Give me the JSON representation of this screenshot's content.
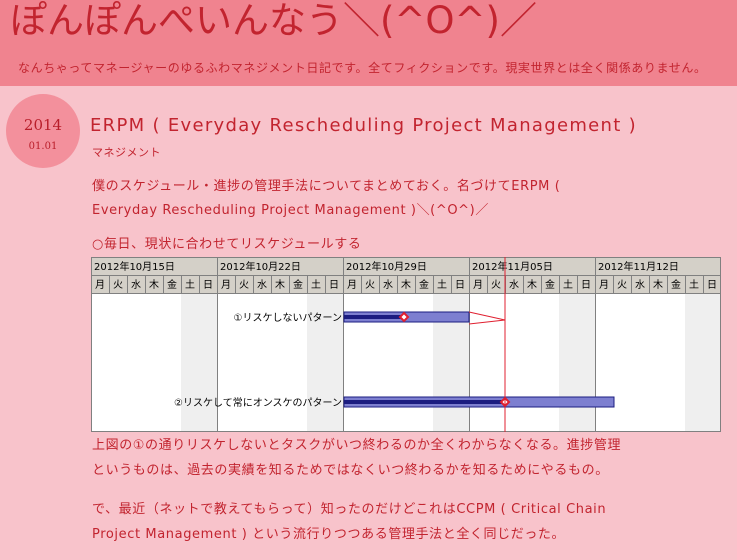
{
  "blog": {
    "title": "ぽんぽんぺいんなう＼(^O^)／",
    "description": "なんちゃってマネージャーのゆるふわマネジメント日記です。全てフィクションです。現実世界とは全く関係ありません。"
  },
  "post": {
    "date_year": "2014",
    "date_md": "01.01",
    "title": "ERPM ( Everyday Rescheduling Project Management )",
    "category": "マネジメント",
    "para1_line1": "僕のスケジュール・進捗の管理手法についてまとめておく。名づけてERPM (",
    "para1_line2": "Everyday Rescheduling Project Management )＼(^O^)／",
    "heading": "○毎日、現状に合わせてリスケジュールする",
    "para2_line1": "上図の①の通りリスケしないとタスクがいつ終わるのか全くわからなくなる。進捗管理",
    "para2_line2": "というものは、過去の実績を知るためではなくいつ終わるかを知るためにやるもの。",
    "para3_line1": "で、最近（ネットで教えてもらって）知ったのだけどこれはCCPM ( Critical Chain",
    "para3_line2": "Project Management ) という流行りつつある管理手法と全く同じだった。"
  },
  "gantt": {
    "weeks": [
      "2012年10月15日",
      "2012年10月22日",
      "2012年10月29日",
      "2012年11月05日",
      "2012年11月12日"
    ],
    "weekdays": [
      "月",
      "火",
      "水",
      "木",
      "金",
      "土",
      "日"
    ],
    "bar1_label": "①リスケしないパターン",
    "bar2_label": "②リスケして常にオンスケのパターン",
    "colors": {
      "bar_fill": "#7d7fd0",
      "bar_done": "#1b1c80",
      "today_line": "#e02030",
      "milestone": "#e02030"
    }
  }
}
